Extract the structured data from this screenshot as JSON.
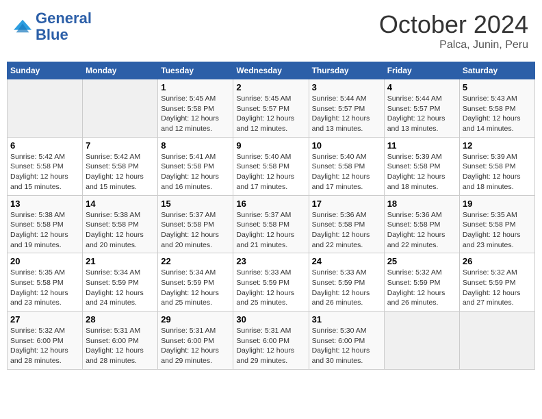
{
  "header": {
    "logo_line1": "General",
    "logo_line2": "Blue",
    "title": "October 2024",
    "subtitle": "Palca, Junin, Peru"
  },
  "calendar": {
    "weekdays": [
      "Sunday",
      "Monday",
      "Tuesday",
      "Wednesday",
      "Thursday",
      "Friday",
      "Saturday"
    ],
    "weeks": [
      [
        {
          "day": null,
          "content": null
        },
        {
          "day": null,
          "content": null
        },
        {
          "day": "1",
          "content": "Sunrise: 5:45 AM\nSunset: 5:58 PM\nDaylight: 12 hours and 12 minutes."
        },
        {
          "day": "2",
          "content": "Sunrise: 5:45 AM\nSunset: 5:57 PM\nDaylight: 12 hours and 12 minutes."
        },
        {
          "day": "3",
          "content": "Sunrise: 5:44 AM\nSunset: 5:57 PM\nDaylight: 12 hours and 13 minutes."
        },
        {
          "day": "4",
          "content": "Sunrise: 5:44 AM\nSunset: 5:57 PM\nDaylight: 12 hours and 13 minutes."
        },
        {
          "day": "5",
          "content": "Sunrise: 5:43 AM\nSunset: 5:58 PM\nDaylight: 12 hours and 14 minutes."
        }
      ],
      [
        {
          "day": "6",
          "content": "Sunrise: 5:42 AM\nSunset: 5:58 PM\nDaylight: 12 hours and 15 minutes."
        },
        {
          "day": "7",
          "content": "Sunrise: 5:42 AM\nSunset: 5:58 PM\nDaylight: 12 hours and 15 minutes."
        },
        {
          "day": "8",
          "content": "Sunrise: 5:41 AM\nSunset: 5:58 PM\nDaylight: 12 hours and 16 minutes."
        },
        {
          "day": "9",
          "content": "Sunrise: 5:40 AM\nSunset: 5:58 PM\nDaylight: 12 hours and 17 minutes."
        },
        {
          "day": "10",
          "content": "Sunrise: 5:40 AM\nSunset: 5:58 PM\nDaylight: 12 hours and 17 minutes."
        },
        {
          "day": "11",
          "content": "Sunrise: 5:39 AM\nSunset: 5:58 PM\nDaylight: 12 hours and 18 minutes."
        },
        {
          "day": "12",
          "content": "Sunrise: 5:39 AM\nSunset: 5:58 PM\nDaylight: 12 hours and 18 minutes."
        }
      ],
      [
        {
          "day": "13",
          "content": "Sunrise: 5:38 AM\nSunset: 5:58 PM\nDaylight: 12 hours and 19 minutes."
        },
        {
          "day": "14",
          "content": "Sunrise: 5:38 AM\nSunset: 5:58 PM\nDaylight: 12 hours and 20 minutes."
        },
        {
          "day": "15",
          "content": "Sunrise: 5:37 AM\nSunset: 5:58 PM\nDaylight: 12 hours and 20 minutes."
        },
        {
          "day": "16",
          "content": "Sunrise: 5:37 AM\nSunset: 5:58 PM\nDaylight: 12 hours and 21 minutes."
        },
        {
          "day": "17",
          "content": "Sunrise: 5:36 AM\nSunset: 5:58 PM\nDaylight: 12 hours and 22 minutes."
        },
        {
          "day": "18",
          "content": "Sunrise: 5:36 AM\nSunset: 5:58 PM\nDaylight: 12 hours and 22 minutes."
        },
        {
          "day": "19",
          "content": "Sunrise: 5:35 AM\nSunset: 5:58 PM\nDaylight: 12 hours and 23 minutes."
        }
      ],
      [
        {
          "day": "20",
          "content": "Sunrise: 5:35 AM\nSunset: 5:58 PM\nDaylight: 12 hours and 23 minutes."
        },
        {
          "day": "21",
          "content": "Sunrise: 5:34 AM\nSunset: 5:59 PM\nDaylight: 12 hours and 24 minutes."
        },
        {
          "day": "22",
          "content": "Sunrise: 5:34 AM\nSunset: 5:59 PM\nDaylight: 12 hours and 25 minutes."
        },
        {
          "day": "23",
          "content": "Sunrise: 5:33 AM\nSunset: 5:59 PM\nDaylight: 12 hours and 25 minutes."
        },
        {
          "day": "24",
          "content": "Sunrise: 5:33 AM\nSunset: 5:59 PM\nDaylight: 12 hours and 26 minutes."
        },
        {
          "day": "25",
          "content": "Sunrise: 5:32 AM\nSunset: 5:59 PM\nDaylight: 12 hours and 26 minutes."
        },
        {
          "day": "26",
          "content": "Sunrise: 5:32 AM\nSunset: 5:59 PM\nDaylight: 12 hours and 27 minutes."
        }
      ],
      [
        {
          "day": "27",
          "content": "Sunrise: 5:32 AM\nSunset: 6:00 PM\nDaylight: 12 hours and 28 minutes."
        },
        {
          "day": "28",
          "content": "Sunrise: 5:31 AM\nSunset: 6:00 PM\nDaylight: 12 hours and 28 minutes."
        },
        {
          "day": "29",
          "content": "Sunrise: 5:31 AM\nSunset: 6:00 PM\nDaylight: 12 hours and 29 minutes."
        },
        {
          "day": "30",
          "content": "Sunrise: 5:31 AM\nSunset: 6:00 PM\nDaylight: 12 hours and 29 minutes."
        },
        {
          "day": "31",
          "content": "Sunrise: 5:30 AM\nSunset: 6:00 PM\nDaylight: 12 hours and 30 minutes."
        },
        {
          "day": null,
          "content": null
        },
        {
          "day": null,
          "content": null
        }
      ]
    ]
  }
}
